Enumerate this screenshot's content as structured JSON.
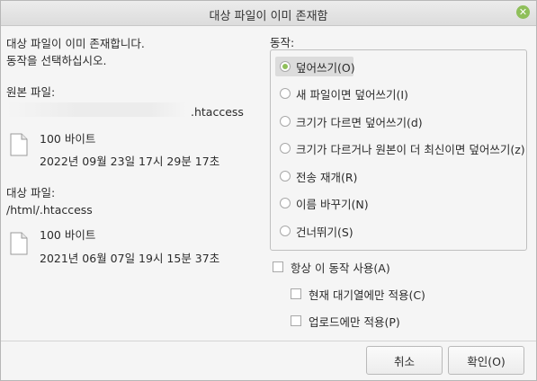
{
  "window": {
    "title": "대상 파일이 이미 존재함",
    "close_icon": "close-icon"
  },
  "message": {
    "line1": "대상 파일이 이미 존재합니다.",
    "line2": "동작을 선택하십시오."
  },
  "source": {
    "label": "원본 파일:",
    "path": ".htaccess",
    "size": "100 바이트",
    "date": "2022년 09월 23일 17시 29분 17초"
  },
  "target": {
    "label": "대상 파일:",
    "path": "/html/.htaccess",
    "size": "100 바이트",
    "date": "2021년 06월 07일 19시 15분 37초"
  },
  "actions": {
    "label": "동작:",
    "options": [
      {
        "label": "덮어쓰기(O)",
        "selected": true
      },
      {
        "label": "새 파일이면 덮어쓰기(I)",
        "selected": false
      },
      {
        "label": "크기가 다르면 덮어쓰기(d)",
        "selected": false
      },
      {
        "label": "크기가 다르거나 원본이 더 최신이면 덮어쓰기(z)",
        "selected": false
      },
      {
        "label": "전송 재개(R)",
        "selected": false
      },
      {
        "label": "이름 바꾸기(N)",
        "selected": false
      },
      {
        "label": "건너뛰기(S)",
        "selected": false
      }
    ]
  },
  "options": {
    "always": {
      "label": "항상 이 동작 사용(A)",
      "checked": false
    },
    "queue_only": {
      "label": "현재 대기열에만 적용(C)",
      "checked": false
    },
    "upload_only": {
      "label": "업로드에만 적용(P)",
      "checked": false
    }
  },
  "buttons": {
    "cancel": "취소",
    "ok": "확인(O)"
  },
  "colors": {
    "accent": "#8fbf5a",
    "selection": "#dcdcdc",
    "window_bg": "#f5f5f5"
  }
}
